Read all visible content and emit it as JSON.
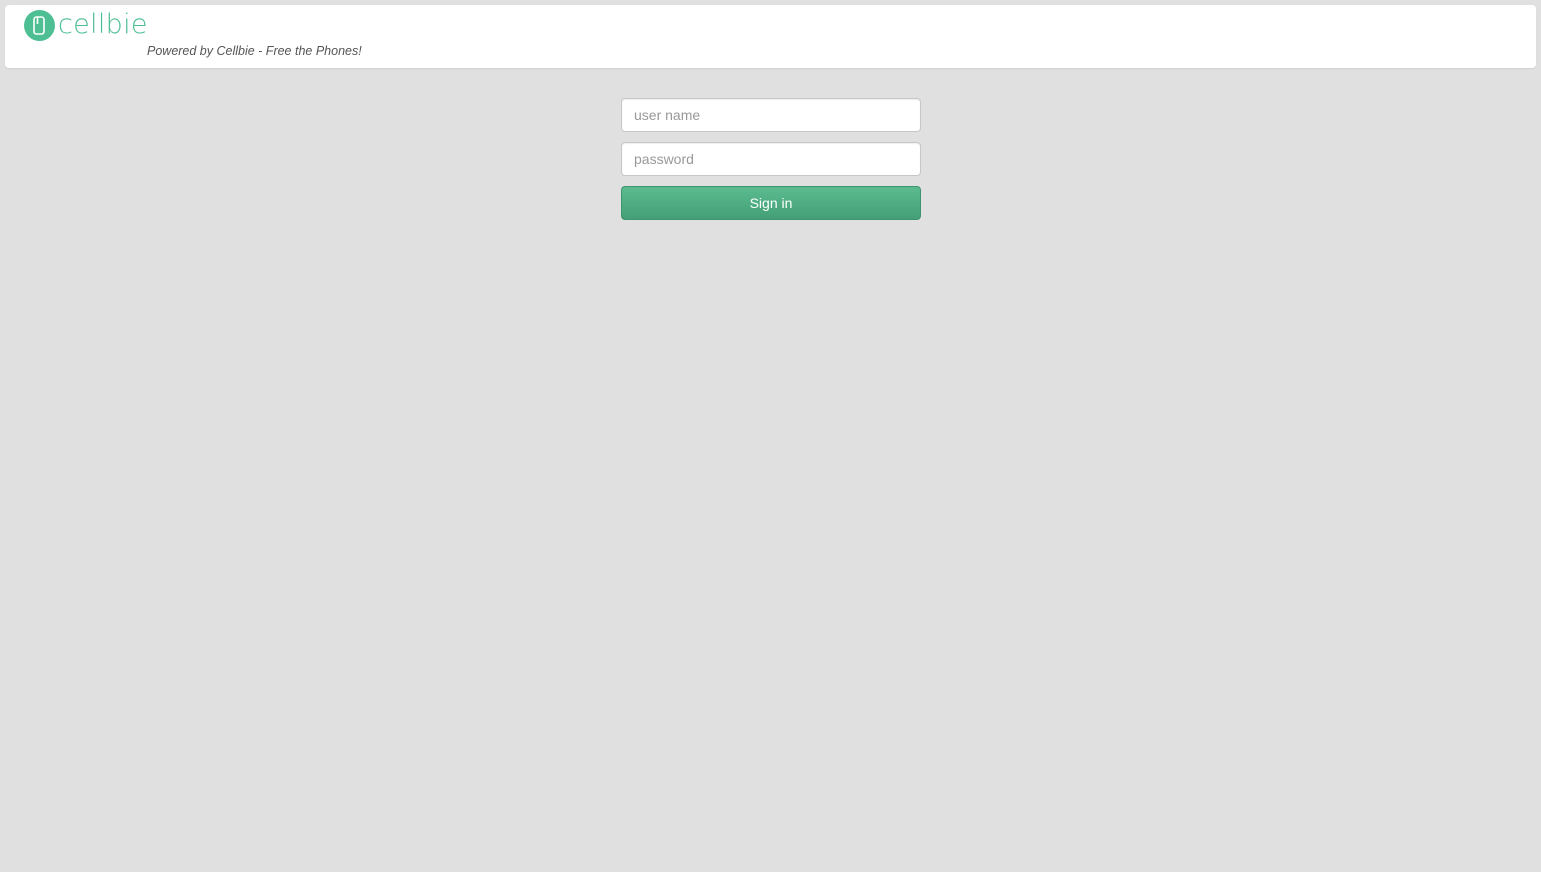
{
  "brand": {
    "name": "cellbie",
    "tagline": "Powered by Cellbie - Free the Phones!",
    "color": "#4dbf93",
    "icon": "phone-icon"
  },
  "login": {
    "username_placeholder": "user name",
    "username_value": "",
    "password_placeholder": "password",
    "password_value": "",
    "signin_label": "Sign in",
    "button_color": "#4aa87f"
  }
}
